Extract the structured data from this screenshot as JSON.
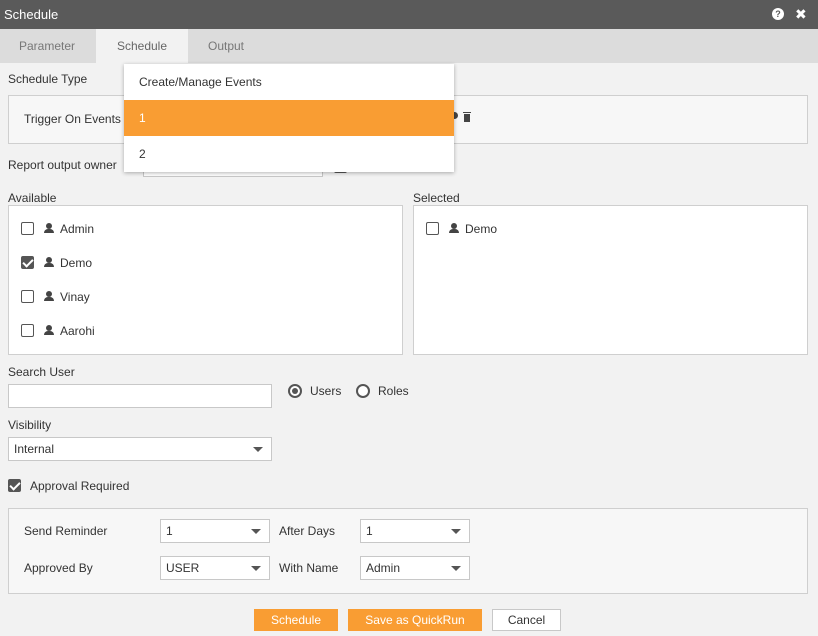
{
  "window": {
    "title": "Schedule",
    "help_icon": "help-circle-icon",
    "help_glyph": "?",
    "close_icon": "close-icon",
    "close_glyph": "✖"
  },
  "tabs": [
    {
      "label": "Parameter",
      "active": false
    },
    {
      "label": "Schedule",
      "active": true
    },
    {
      "label": "Output",
      "active": false
    }
  ],
  "schedule_type": {
    "label": "Schedule Type",
    "trigger_label": "Trigger On Events",
    "event_options": [
      "Create/Manage Events",
      "1",
      "2"
    ],
    "selected_option": "1",
    "settings_icon": "gear-icon",
    "delete_icon": "trash-icon"
  },
  "report_owner": {
    "label": "Report output owner"
  },
  "available": {
    "label": "Available",
    "users": [
      {
        "name": "Admin",
        "checked": false
      },
      {
        "name": "Demo",
        "checked": true
      },
      {
        "name": "Vinay",
        "checked": false
      },
      {
        "name": "Aarohi",
        "checked": false
      }
    ]
  },
  "selected": {
    "label": "Selected",
    "users": [
      {
        "name": "Demo",
        "checked": false
      }
    ]
  },
  "search_user": {
    "label": "Search User",
    "value": "",
    "radio_users": "Users",
    "radio_roles": "Roles",
    "selected_radio": "Users"
  },
  "visibility": {
    "label": "Visibility",
    "value": "Internal"
  },
  "approval": {
    "label": "Approval Required",
    "checked": true,
    "send_reminder_label": "Send Reminder",
    "send_reminder_value": "1",
    "after_days_label": "After Days",
    "after_days_value": "1",
    "approved_by_label": "Approved By",
    "approved_by_value": "USER",
    "with_name_label": "With Name",
    "with_name_value": "Admin"
  },
  "buttons": {
    "schedule": "Schedule",
    "save_quickrun": "Save as QuickRun",
    "cancel": "Cancel"
  },
  "colors": {
    "accent": "#f99d33",
    "titlebar": "#5a5a5a",
    "background": "#f2f2f2"
  }
}
